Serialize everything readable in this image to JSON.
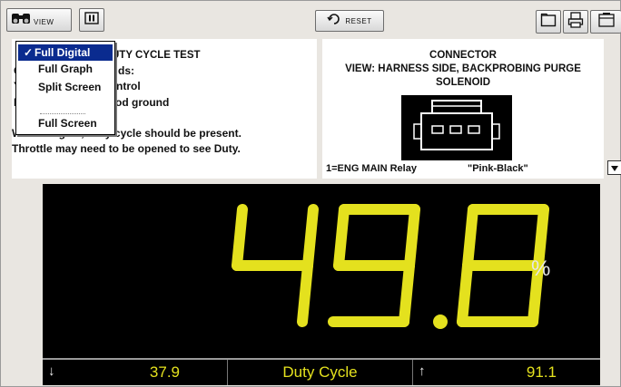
{
  "toolbar": {
    "view_label": "VIEW",
    "reset_label": "RESET",
    "icons": [
      "binoculars-icon",
      "pause-icon",
      "reset-icon",
      "folder-icon",
      "print-icon",
      "more-icon"
    ]
  },
  "view_menu": {
    "items": [
      {
        "label": "Full Digital",
        "selected": true,
        "check": "✓"
      },
      {
        "label": "Full Graph",
        "selected": false
      },
      {
        "label": "Split Screen",
        "selected": false
      },
      {
        "label": "Full Screen",
        "selected": false
      }
    ]
  },
  "test_panel": {
    "title_visible": "UTY CYCLE TEST",
    "line1_suffix": "ds:",
    "line1_prefix": "C",
    "line2_prefix": "Y",
    "line2_suffix": "ntrol",
    "line3_prefix": "E",
    "line3_suffix": "od ground",
    "line4": "Warm Engine, Duty cycle should be present.",
    "line5": "Throttle may need to be opened to see Duty."
  },
  "connector": {
    "title": "CONNECTOR",
    "view_line1": "VIEW: HARNESS SIDE, BACKPROBING PURGE",
    "view_line2": "SOLENOID",
    "pin_label": "1=ENG MAIN Relay",
    "pin_color": "\"Pink-Black\""
  },
  "reading": {
    "value": "49.8",
    "unit": "%",
    "min": "37.9",
    "max": "91.1",
    "name": "Duty Cycle",
    "min_arrow": "↓",
    "max_arrow": "↑"
  },
  "colors": {
    "segment": "#e4e11e",
    "menu_selected": "#0a2b8f",
    "display_bg": "#000000"
  }
}
